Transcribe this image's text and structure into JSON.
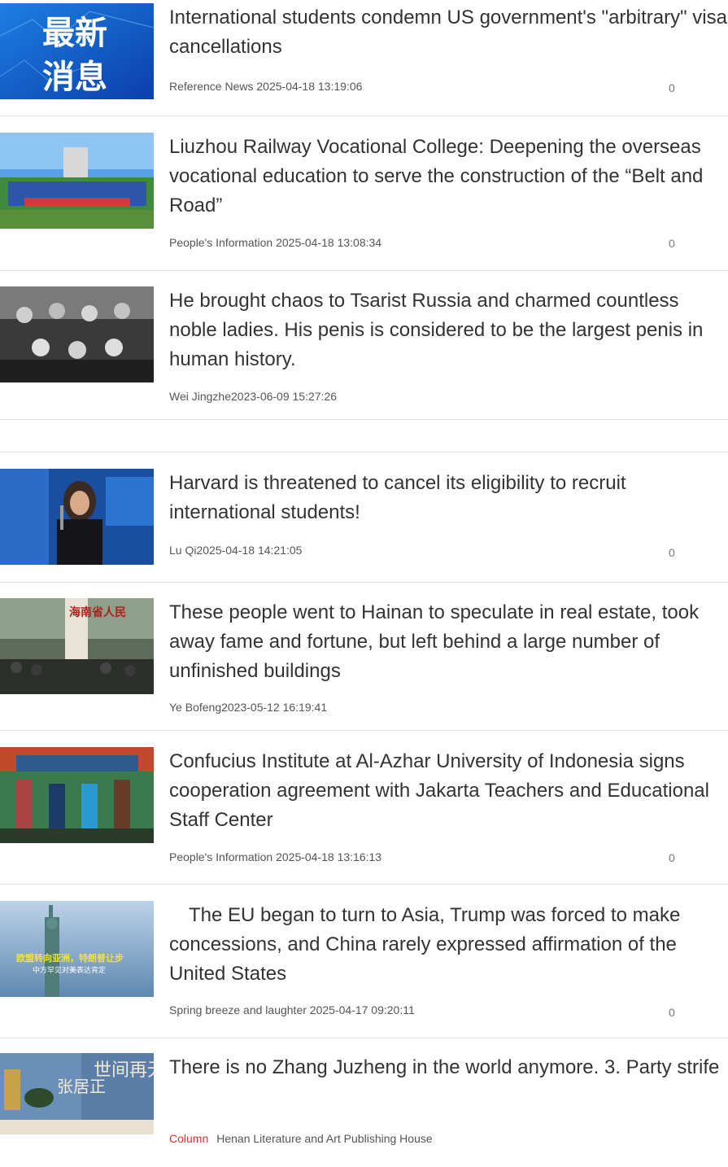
{
  "articles": [
    {
      "thumb": "latest-news-banner",
      "thumb_text": [
        "最新",
        "消息"
      ],
      "title": "International students condemn US government's \"arbitrary\" visa cancellations",
      "source": "Reference News",
      "time": "2025-04-18 13:19:06",
      "count": "0"
    },
    {
      "thumb": "group-photo-banner",
      "title": "Liuzhou Railway Vocational College: Deepening the overseas vocational education to serve the construction of the “Belt and Road”",
      "source": "People's Information",
      "time": "2025-04-18 13:08:34",
      "count": "0"
    },
    {
      "thumb": "historical-bw-photo",
      "title": "He brought chaos to Tsarist Russia and charmed countless noble ladies. His penis is considered to be the largest penis in human history.",
      "source": "Wei Jingzhe",
      "time": "2023-06-09 15:27:26"
    },
    {
      "thumb": "speaker-photo",
      "title": "Harvard is threatened to cancel its eligibility to recruit international students!",
      "source": "Lu Qi",
      "time": "2025-04-18 14:21:05",
      "count": "0"
    },
    {
      "thumb": "hainan-crowd-photo",
      "thumb_text": "海南省人民",
      "title": "These people went to Hainan to speculate in real estate, took away fame and fortune, but left behind a large number of unfinished buildings",
      "source": "Ye Bofeng",
      "time": "2023-05-12 16:19:41"
    },
    {
      "thumb": "signing-ceremony-photo",
      "title": "Confucius Institute at Al-Azhar University of Indonesia signs cooperation agreement with Jakarta Teachers and Educational Staff Center",
      "source": "People's Information",
      "time": "2025-04-18 13:16:13",
      "count": "0"
    },
    {
      "thumb": "statue-of-liberty-photo",
      "thumb_text": [
        "欧盟转向亚洲，特朗普让步",
        "中方罕见对美表达肯定"
      ],
      "title": "　The EU began to turn to Asia, Trump was forced to make concessions, and China rarely expressed affirmation of the United States",
      "source": "Spring breeze and laughter",
      "time": "2025-04-17 09:20:11",
      "count": "0"
    },
    {
      "thumb": "book-cover",
      "thumb_text": [
        "张居正",
        "世间再无"
      ],
      "title": "There is no Zhang Juzheng in the world anymore. 3. Party strife",
      "tag": "Column",
      "source": "Henan Literature and Art Publishing House"
    }
  ],
  "colors": {
    "tag": "#e0312f",
    "title": "#333333",
    "meta": "#555555",
    "divider": "#e6e6e6"
  }
}
